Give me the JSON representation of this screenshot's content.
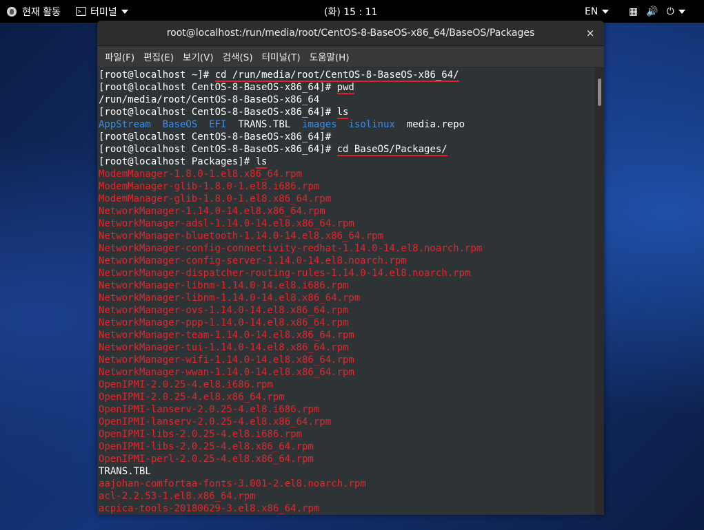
{
  "topbar": {
    "activities": "현재 활동",
    "app": "터미널",
    "clock": "(화) 15 : 11",
    "lang": "EN"
  },
  "window": {
    "title": "root@localhost:/run/media/root/CentOS-8-BaseOS-x86_64/BaseOS/Packages",
    "close": "×"
  },
  "menu": {
    "file": "파일(F)",
    "edit": "편집(E)",
    "view": "보기(V)",
    "search": "검색(S)",
    "terminal": "터미널(T)",
    "help": "도움말(H)"
  },
  "terminal": {
    "l1_prompt": "[root@localhost ~]# ",
    "l1_cmd": "cd /run/media/root/CentOS-8-BaseOS-x86_64/",
    "l2_prompt": "[root@localhost CentOS-8-BaseOS-x86_64]# ",
    "l2_cmd": "pwd",
    "l3": "/run/media/root/CentOS-8-BaseOS-x86_64",
    "l4_prompt": "[root@localhost CentOS-8-BaseOS-x86_64]# ",
    "l4_cmd": "ls",
    "ls_appstream": "AppStream",
    "ls_baseos": "BaseOS",
    "ls_efi": "EFI",
    "ls_trans": "TRANS.TBL",
    "ls_images": "images",
    "ls_isolinux": "isolinux",
    "ls_media": "media.repo",
    "l6": "[root@localhost CentOS-8-BaseOS-x86_64]#",
    "l7_prompt": "[root@localhost CentOS-8-BaseOS-x86_64]# ",
    "l7_cmd": "cd BaseOS/Packages/",
    "l8_prompt": "[root@localhost Packages]# ",
    "l8_cmd": "ls",
    "packages": [
      "ModemManager-1.8.0-1.el8.x86_64.rpm",
      "ModemManager-glib-1.8.0-1.el8.i686.rpm",
      "ModemManager-glib-1.8.0-1.el8.x86_64.rpm",
      "NetworkManager-1.14.0-14.el8.x86_64.rpm",
      "NetworkManager-adsl-1.14.0-14.el8.x86_64.rpm",
      "NetworkManager-bluetooth-1.14.0-14.el8.x86_64.rpm",
      "NetworkManager-config-connectivity-redhat-1.14.0-14.el8.noarch.rpm",
      "NetworkManager-config-server-1.14.0-14.el8.noarch.rpm",
      "NetworkManager-dispatcher-routing-rules-1.14.0-14.el8.noarch.rpm",
      "NetworkManager-libnm-1.14.0-14.el8.i686.rpm",
      "NetworkManager-libnm-1.14.0-14.el8.x86_64.rpm",
      "NetworkManager-ovs-1.14.0-14.el8.x86_64.rpm",
      "NetworkManager-ppp-1.14.0-14.el8.x86_64.rpm",
      "NetworkManager-team-1.14.0-14.el8.x86_64.rpm",
      "NetworkManager-tui-1.14.0-14.el8.x86_64.rpm",
      "NetworkManager-wifi-1.14.0-14.el8.x86_64.rpm",
      "NetworkManager-wwan-1.14.0-14.el8.x86_64.rpm",
      "OpenIPMI-2.0.25-4.el8.i686.rpm",
      "OpenIPMI-2.0.25-4.el8.x86_64.rpm",
      "OpenIPMI-lanserv-2.0.25-4.el8.i686.rpm",
      "OpenIPMI-lanserv-2.0.25-4.el8.x86_64.rpm",
      "OpenIPMI-libs-2.0.25-4.el8.i686.rpm",
      "OpenIPMI-libs-2.0.25-4.el8.x86_64.rpm",
      "OpenIPMI-perl-2.0.25-4.el8.x86_64.rpm"
    ],
    "trans": "TRANS.TBL",
    "packages2": [
      "aajohan-comfortaa-fonts-3.001-2.el8.noarch.rpm",
      "acl-2.2.53-1.el8.x86_64.rpm",
      "acpica-tools-20180629-3.el8.x86_64.rpm"
    ]
  }
}
